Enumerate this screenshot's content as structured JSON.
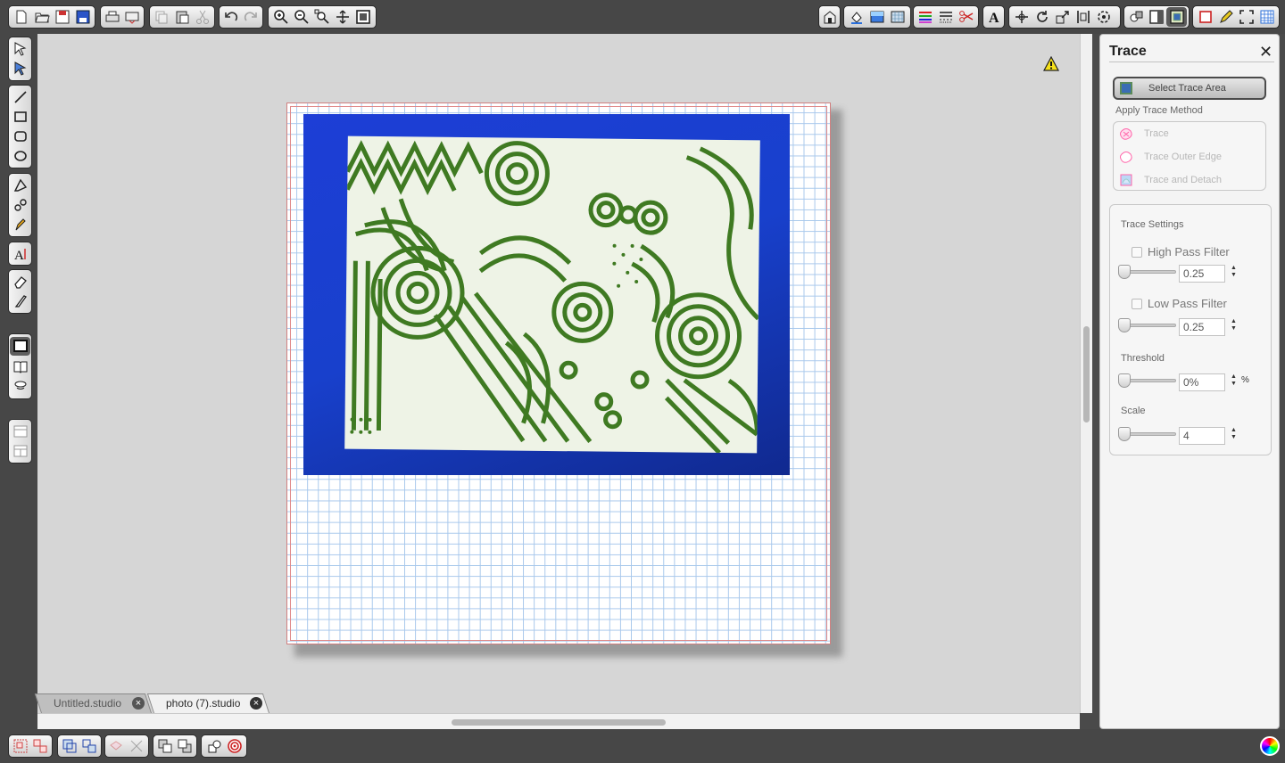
{
  "workspace": {
    "warning_icon": "warning-icon"
  },
  "tabs": [
    {
      "label": "Untitled.studio",
      "close": "×"
    },
    {
      "label": "photo (7).studio",
      "close": "×"
    }
  ],
  "panel": {
    "title": "Trace",
    "close": "✕",
    "select_trace_area": "Select Trace Area",
    "apply_trace_method": "Apply Trace Method",
    "methods": [
      {
        "label": "Trace"
      },
      {
        "label": "Trace Outer Edge"
      },
      {
        "label": "Trace and Detach"
      }
    ],
    "trace_settings": "Trace Settings",
    "high_pass": {
      "label": "High Pass Filter",
      "checked": false,
      "value": "0.25"
    },
    "low_pass": {
      "label": "Low Pass Filter",
      "checked": false,
      "value": "0.25"
    },
    "threshold": {
      "label": "Threshold",
      "value": "0%",
      "unit": "%"
    },
    "scale": {
      "label": "Scale",
      "value": "4"
    }
  },
  "colors": {
    "photo_background": "#1d3ed6",
    "doodle_ink": "#3f7a22",
    "grid": "#a8c8ec"
  }
}
